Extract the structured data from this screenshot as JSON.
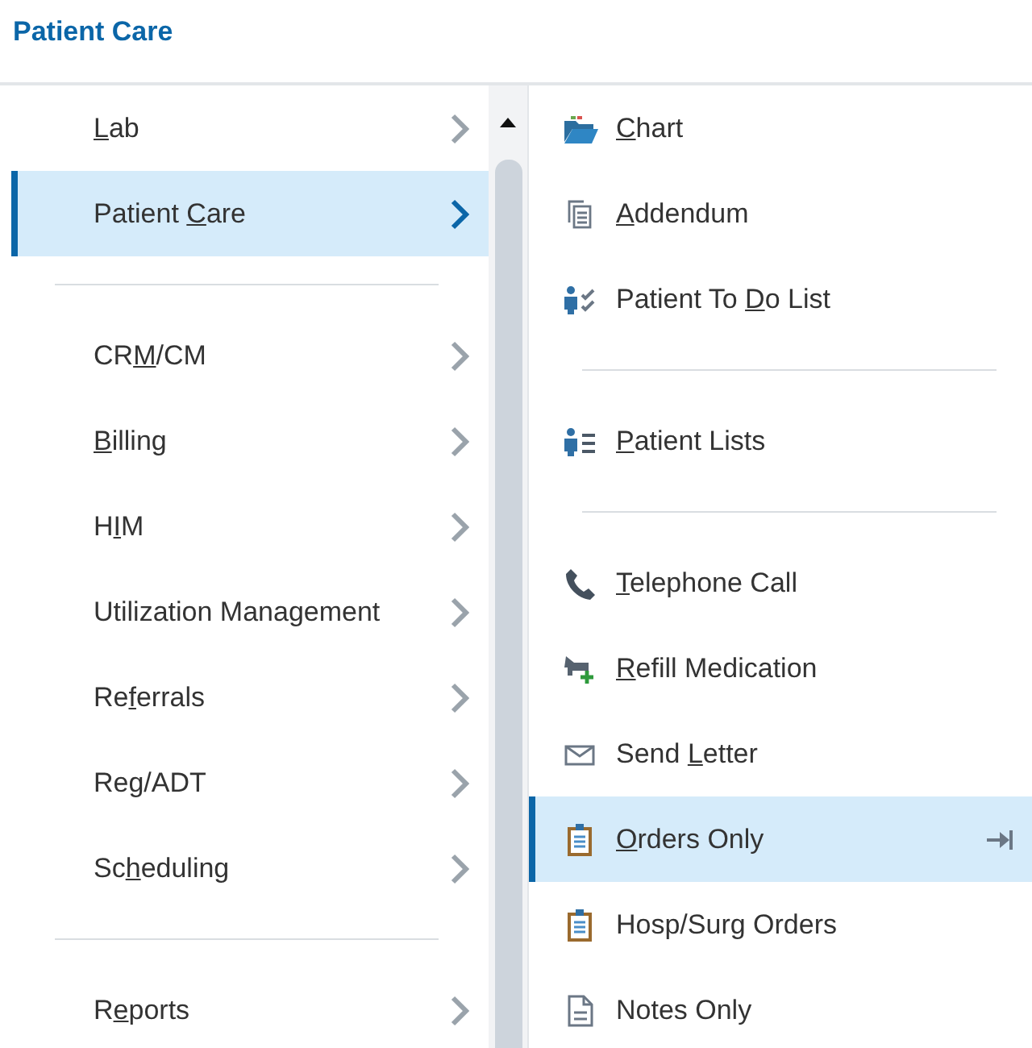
{
  "header": {
    "title": "Patient Care"
  },
  "menu": {
    "items": [
      {
        "kind": "submenu",
        "access_key": "L",
        "label_end": "ab",
        "selected": false
      },
      {
        "kind": "submenu",
        "label_start": "Patient ",
        "access_key": "C",
        "label_end": "are",
        "selected": true
      },
      {
        "kind": "separator"
      },
      {
        "kind": "submenu",
        "label_start": "CR",
        "access_key": "M",
        "label_end": "/CM",
        "selected": false
      },
      {
        "kind": "submenu",
        "access_key": "B",
        "label_end": "illing",
        "selected": false
      },
      {
        "kind": "submenu",
        "label_start": "H",
        "access_key": "I",
        "label_end": "M",
        "selected": false
      },
      {
        "kind": "submenu",
        "label_start": "Utilization Management",
        "selected": false
      },
      {
        "kind": "submenu",
        "label_start": "Re",
        "access_key": "f",
        "label_end": "errals",
        "selected": false
      },
      {
        "kind": "submenu",
        "label_start": "Reg/ADT",
        "selected": false
      },
      {
        "kind": "submenu",
        "label_start": "Sc",
        "access_key": "h",
        "label_end": "eduling",
        "selected": false
      },
      {
        "kind": "separator"
      },
      {
        "kind": "submenu",
        "label_start": "R",
        "access_key": "e",
        "label_end": "ports",
        "selected": false
      }
    ]
  },
  "submenu": {
    "items": [
      {
        "kind": "folder",
        "access_key": "C",
        "label_end": "hart",
        "selected": false
      },
      {
        "kind": "pages",
        "access_key": "A",
        "label_end": "ddendum",
        "selected": false
      },
      {
        "kind": "personcheck",
        "label_start": "Patient To ",
        "access_key": "D",
        "label_end": "o List",
        "selected": false
      },
      {
        "kind": "separator"
      },
      {
        "kind": "personlist",
        "access_key": "P",
        "label_end": "atient Lists",
        "selected": false
      },
      {
        "kind": "separator"
      },
      {
        "kind": "phone",
        "access_key": "T",
        "label_end": "elephone Call",
        "selected": false
      },
      {
        "kind": "refill",
        "access_key": "R",
        "label_end": "efill Medication",
        "selected": false
      },
      {
        "kind": "envelope",
        "label_start": "Send ",
        "access_key": "L",
        "label_end": "etter",
        "selected": false
      },
      {
        "kind": "clipboard",
        "access_key": "O",
        "label_end": "rders Only",
        "selected": true,
        "pinnable": true
      },
      {
        "kind": "clipboard",
        "label_start": "Hosp/Surg Orders",
        "selected": false
      },
      {
        "kind": "document",
        "label_start": "Notes Only",
        "selected": false
      }
    ]
  }
}
